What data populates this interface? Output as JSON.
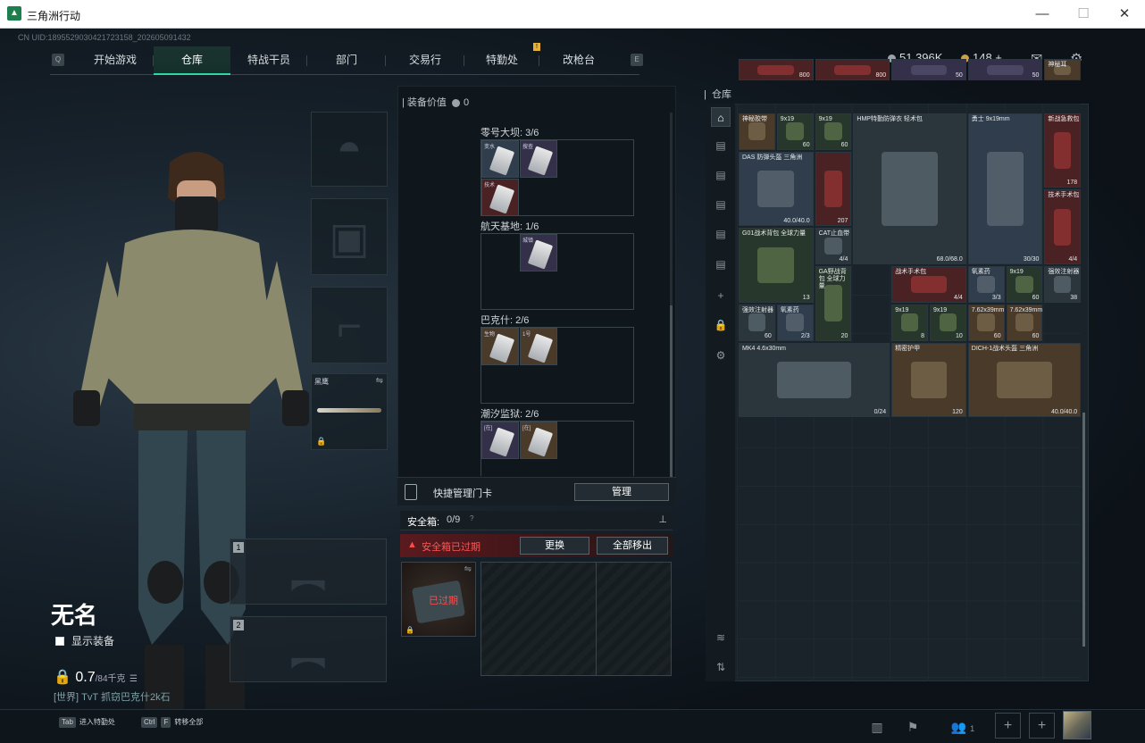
{
  "window": {
    "title": "三角洲行动",
    "logo": "delta-logo-icon"
  },
  "uid": "CN UID:1895529030421723158_202605091432",
  "nav": {
    "tabs": [
      "开始游戏",
      "仓库",
      "特战干员",
      "部门",
      "交易行",
      "特勤处",
      "改枪台"
    ],
    "active": "仓库",
    "left_key": "Q",
    "right_key": "E",
    "badge": "!"
  },
  "currency": {
    "coins": "51,396K",
    "premium": "148 +"
  },
  "character": {
    "name": "无名",
    "show_equipment": "显示装备",
    "weight": "0.7",
    "weight_limit": "/84千克",
    "chat": "[世界] TvT  抓窃巴克什2k石",
    "melee_slot_label": "黑鹰",
    "weapon_slots": [
      "1",
      "2"
    ]
  },
  "equipment": {
    "title": "装备价值",
    "value": "0",
    "sections": [
      {
        "label": "零号大坝: 3/6",
        "items": [
          "变水",
          "搜查",
          "技术"
        ]
      },
      {
        "label": "航天基地: 1/6",
        "items": [
          "城镇"
        ]
      },
      {
        "label": "巴克什: 2/6",
        "items": [
          "生物",
          "1号"
        ]
      },
      {
        "label": "潮汐监狱: 2/6",
        "items": [
          "[在]",
          "[在]"
        ]
      }
    ]
  },
  "quick": {
    "label": "快捷管理门卡",
    "button": "管理"
  },
  "safe": {
    "label": "安全箱:",
    "value": "0/9",
    "expired_text": "安全箱已过期",
    "replace": "更换",
    "move_all": "全部移出",
    "item_tag": "已过期"
  },
  "storage": {
    "title": "仓库",
    "items": [
      {
        "title": "",
        "value": "800",
        "bg": "red"
      },
      {
        "title": "",
        "value": "800",
        "bg": "red"
      },
      {
        "title": "",
        "value": "50",
        "bg": "purple"
      },
      {
        "title": "",
        "value": "50",
        "bg": "purple"
      },
      {
        "title": "神秘耳",
        "value": "",
        "bg": "gold"
      },
      {
        "title": "神秘胶带",
        "value": "",
        "bg": "gold"
      },
      {
        "title": "9x19",
        "value": "60",
        "bg": "green"
      },
      {
        "title": "9x19",
        "value": "60",
        "bg": "green"
      },
      {
        "title": "HMP特勤防弹衣 轻术包",
        "value": "68.0/68.0",
        "bg": "grey"
      },
      {
        "title": "勇士 9x19mm",
        "value": "30/30",
        "bg": "blue"
      },
      {
        "title": "新战急救包",
        "value": "178",
        "bg": "red"
      },
      {
        "title": "DAS 防弹头盔 三角洲",
        "value": "40.0/40.0",
        "bg": "blue"
      },
      {
        "title": "",
        "value": "207",
        "bg": "red"
      },
      {
        "title": "技术手术包",
        "value": "4/4",
        "bg": "red"
      },
      {
        "title": "G01战术背包 全球力量",
        "value": "13",
        "bg": "green"
      },
      {
        "title": "CAT止血带",
        "value": "4/4",
        "bg": "grey"
      },
      {
        "title": "GA野战背包 全球力量",
        "value": "20",
        "bg": "green"
      },
      {
        "title": "战术手术包",
        "value": "4/4",
        "bg": "red"
      },
      {
        "title": "氧素药",
        "value": "3/3",
        "bg": "blue"
      },
      {
        "title": "9x19",
        "value": "60",
        "bg": "green"
      },
      {
        "title": "强效注射器",
        "value": "38",
        "bg": "grey"
      },
      {
        "title": "强效注射器",
        "value": "60",
        "bg": "grey"
      },
      {
        "title": "氧素药",
        "value": "2/3",
        "bg": "blue"
      },
      {
        "title": "9x19",
        "value": "8",
        "bg": "green"
      },
      {
        "title": "9x19",
        "value": "10",
        "bg": "green"
      },
      {
        "title": "7.62x39mm",
        "value": "60",
        "bg": "gold"
      },
      {
        "title": "7.62x39mm",
        "value": "60",
        "bg": "gold"
      },
      {
        "title": "MK4 4.6x30mm",
        "value": "0/24",
        "bg": "grey"
      },
      {
        "title": "精密护甲",
        "value": "120",
        "bg": "gold"
      },
      {
        "title": "DICH-1战术头盔 三角洲",
        "value": "40.0/40.0",
        "bg": "gold"
      }
    ]
  },
  "bottom": {
    "key1": "Tab",
    "label1": "进入特勤处",
    "key2": "Ctrl",
    "key2b": "F",
    "label2": "转移全部",
    "party": "1"
  }
}
